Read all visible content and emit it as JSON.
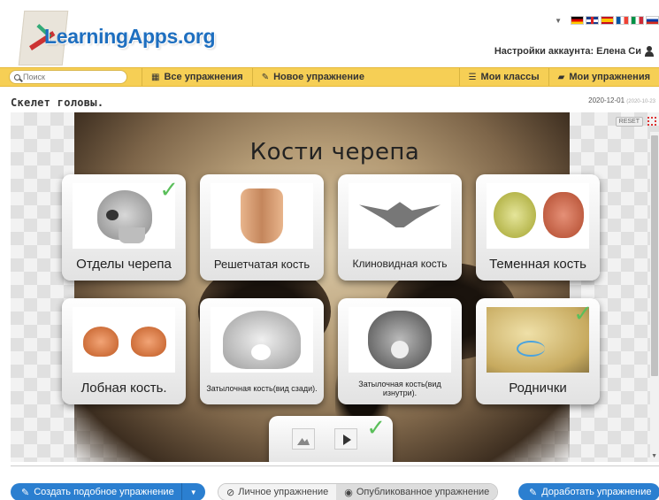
{
  "header": {
    "logo_text": "LearningApps.org",
    "account_label": "Настройки аккаунта: Елена Си"
  },
  "languages": [
    "de",
    "gb",
    "es",
    "fr",
    "it",
    "ru"
  ],
  "navbar": {
    "search_placeholder": "Поиск",
    "all_exercises": "Все упражнения",
    "new_exercise": "Новое упражнение",
    "my_classes": "Мои классы",
    "my_exercises": "Мои упражнения",
    "bg_color": "#f6cf55"
  },
  "exercise": {
    "title": "Скелет головы.",
    "date": "2020-12-01",
    "date_small": "(2020-10-23",
    "heading": "Кости черепа",
    "reset_label": "RESET",
    "cards": [
      {
        "label": "Отделы черепа",
        "checked": true
      },
      {
        "label": "Решетчатая кость",
        "checked": false
      },
      {
        "label": "Клиновидная кость",
        "checked": false
      },
      {
        "label": "Теменная кость",
        "checked": false
      },
      {
        "label": "Лобная кость.",
        "checked": false
      },
      {
        "label": "Затылочная кость(вид сзади).",
        "checked": false
      },
      {
        "label": "Затылочная кость(вид изнутри).",
        "checked": false
      },
      {
        "label": "Роднички",
        "checked": true
      }
    ],
    "check_mark": "✓"
  },
  "footer": {
    "create_similar": "Создать подобное упражнение",
    "private_exercise": "Личное упражнение",
    "published_exercise": "Опубликованное упражнение",
    "improve_exercise": "Доработать упражнение",
    "accent_color": "#2b7fd0",
    "check_color": "#5bbf5b"
  }
}
